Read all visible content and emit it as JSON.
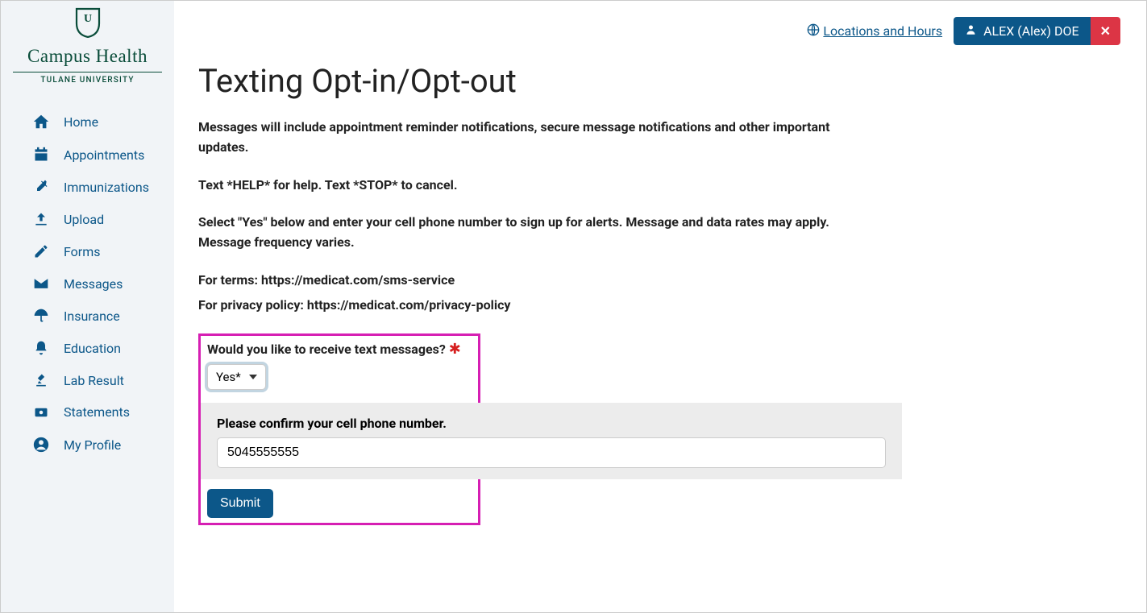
{
  "brand": {
    "title": "Campus Health",
    "subtitle": "TULANE UNIVERSITY"
  },
  "sidebar": {
    "items": [
      {
        "label": "Home"
      },
      {
        "label": "Appointments"
      },
      {
        "label": "Immunizations"
      },
      {
        "label": "Upload"
      },
      {
        "label": "Forms"
      },
      {
        "label": "Messages"
      },
      {
        "label": "Insurance"
      },
      {
        "label": "Education"
      },
      {
        "label": "Lab Result"
      },
      {
        "label": "Statements"
      },
      {
        "label": "My Profile"
      }
    ]
  },
  "topbar": {
    "locations_link": "Locations and Hours",
    "user_name": "ALEX (Alex) DOE"
  },
  "page": {
    "title": "Texting Opt-in/Opt-out",
    "para1": "Messages will include appointment reminder notifications, secure message notifications and other important updates.",
    "para2": "Text *HELP* for help. Text *STOP* to cancel.",
    "para3": "Select \"Yes\" below and enter your cell phone number to sign up for alerts. Message and data rates may apply. Message frequency varies.",
    "terms_line": "For terms: https://medicat.com/sms-service",
    "privacy_line": "For privacy policy: https://medicat.com/privacy-policy",
    "question_label": "Would you like to receive text messages?",
    "select_value": "Yes*",
    "phone_label": "Please confirm your cell phone number.",
    "phone_value": "5045555555",
    "submit_label": "Submit"
  }
}
